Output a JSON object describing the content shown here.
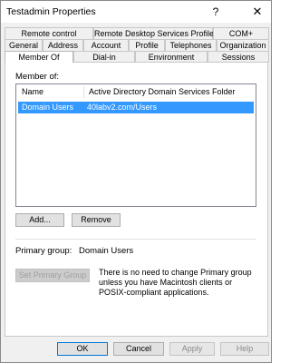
{
  "window": {
    "title": "Testadmin Properties",
    "help_glyph": "?",
    "close_glyph": "✕"
  },
  "tabs": {
    "row1": [
      "Remote control",
      "Remote Desktop Services Profile",
      "COM+"
    ],
    "row2": [
      "General",
      "Address",
      "Account",
      "Profile",
      "Telephones",
      "Organization"
    ],
    "row3": [
      "Member Of",
      "Dial-in",
      "Environment",
      "Sessions"
    ],
    "active": "Member Of"
  },
  "member_of": {
    "label": "Member of:",
    "columns": [
      "Name",
      "Active Directory Domain Services Folder"
    ],
    "rows": [
      {
        "name": "Domain Users",
        "folder": "40labv2.com/Users",
        "selected": true
      }
    ]
  },
  "buttons": {
    "add": "Add...",
    "remove": "Remove",
    "set_primary": "Set Primary Group",
    "ok": "OK",
    "cancel": "Cancel",
    "apply": "Apply",
    "help": "Help"
  },
  "primary_group": {
    "label": "Primary group:",
    "value": "Domain Users",
    "info": "There is no need to change Primary group unless you have Macintosh clients or POSIX-compliant applications."
  },
  "colors": {
    "selection": "#3399ff",
    "default_button_border": "#0078d7"
  }
}
